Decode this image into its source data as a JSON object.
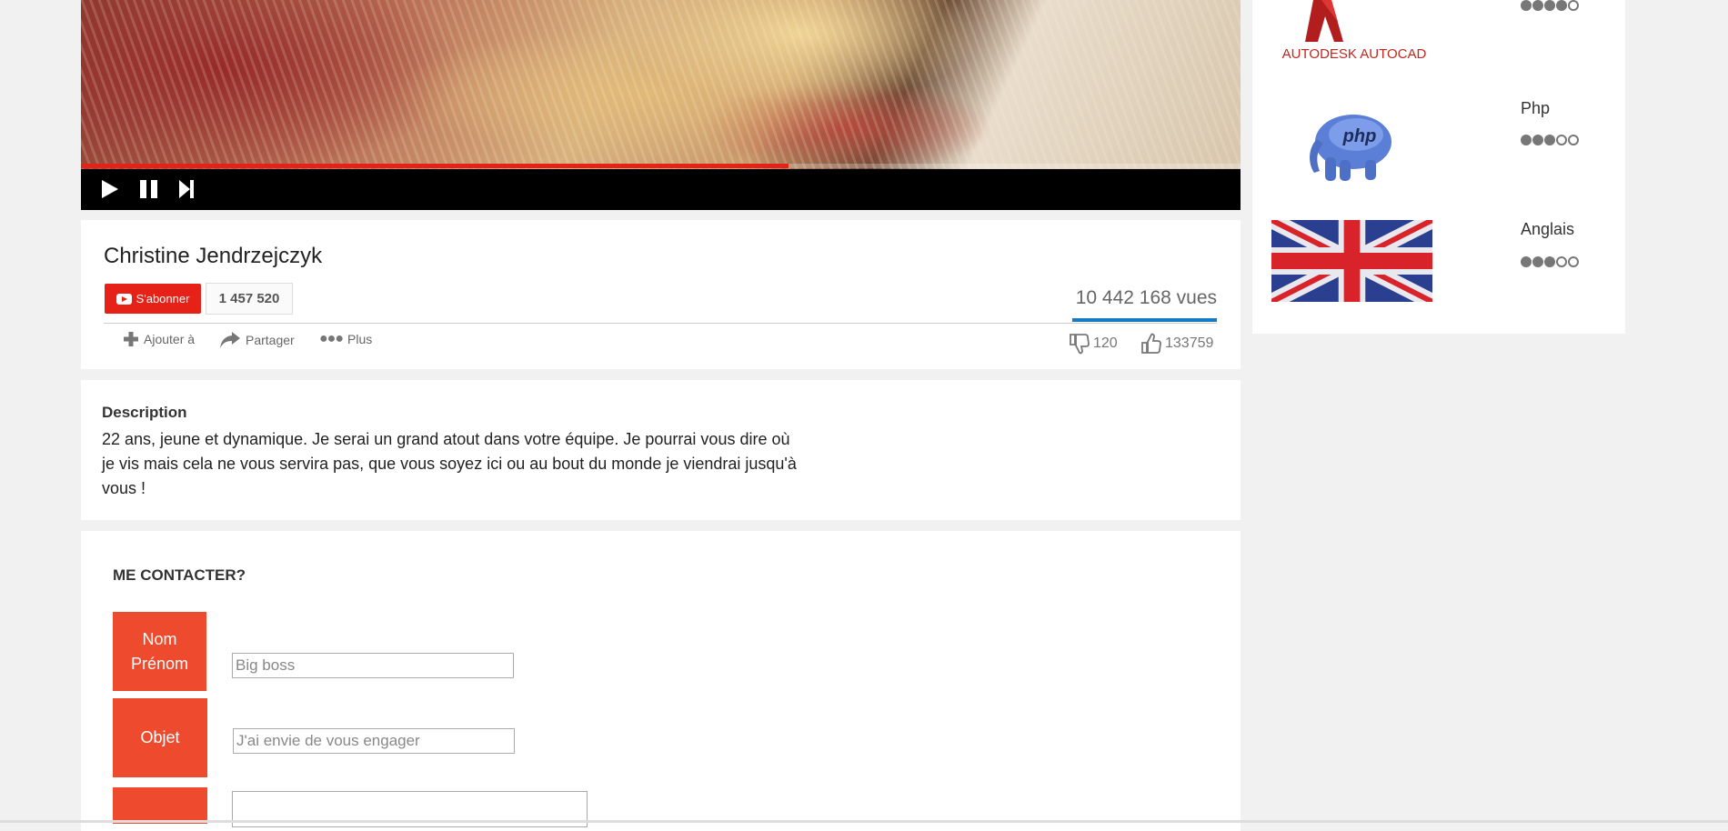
{
  "video": {
    "progress_percent": 61,
    "controls": [
      "play-icon",
      "pause-icon",
      "next-icon"
    ],
    "accent_color": "#e62117"
  },
  "channel": {
    "name": "Christine Jendrzejczyk",
    "subscribe_label": "S'abonner",
    "subscriber_count": "1 457 520",
    "views": "10 442 168 vues",
    "actions": {
      "add_label": "Ajouter à",
      "share_label": "Partager",
      "more_label": "Plus"
    },
    "dislikes": "120",
    "likes": "133759"
  },
  "description": {
    "title": "Description",
    "text": "22 ans, jeune et dynamique. Je serai un grand atout dans votre équipe. Je pourrai vous dire où je vis mais cela ne vous servira pas, que vous soyez ici ou au bout du monde je viendrai jusqu'à vous !"
  },
  "contact": {
    "title": "ME CONTACTER?",
    "fields": [
      {
        "label_line1": "Nom",
        "label_line2": "Prénom",
        "placeholder": "Big boss"
      },
      {
        "label": "Objet",
        "placeholder": "J'ai envie de vous engager"
      },
      {
        "label": ""
      }
    ],
    "label_color": "#ee4b2e"
  },
  "skills": [
    {
      "name": "",
      "logo_text": "AUTODESK AUTOCAD",
      "icon": "autocad-logo",
      "rating": 4,
      "max": 5
    },
    {
      "name": "Php",
      "logo_text": "php",
      "icon": "php-elephant-logo",
      "rating": 3,
      "max": 5
    },
    {
      "name": "Anglais",
      "icon": "uk-flag",
      "rating": 3,
      "max": 5
    }
  ]
}
